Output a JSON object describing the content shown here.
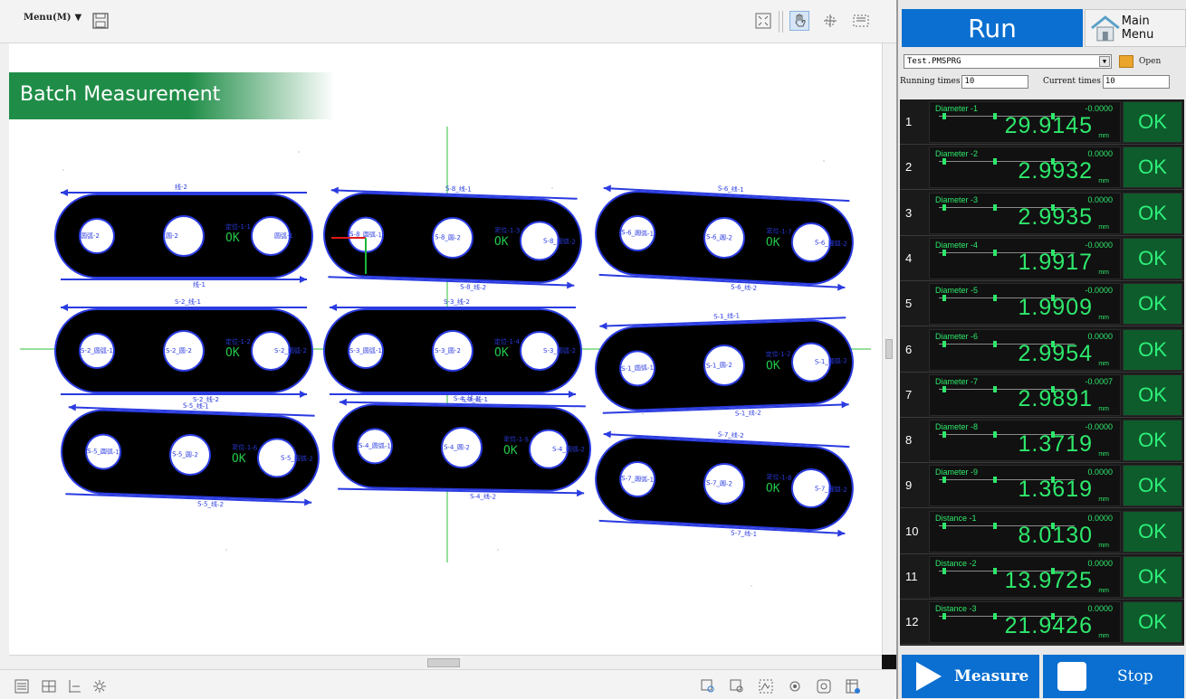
{
  "toolbar": {
    "menu_label": "Menu(M)",
    "icons": [
      "save-icon",
      "fit-screen-icon",
      "hand-pan-icon",
      "crosshair-icon",
      "zoom-region-icon"
    ]
  },
  "banner": {
    "title": "Batch Measurement"
  },
  "accent_color": "#1f8d47",
  "right_panel": {
    "run_label": "Run",
    "main_menu_label": "Main Menu",
    "file": "Test.PMSPRG",
    "open_label": "Open",
    "running_times_label": "Running times",
    "running_times_value": "10",
    "current_times_label": "Current times",
    "current_times_value": "10",
    "ok_color": "#0e5c2c",
    "results": [
      {
        "num": "1",
        "name": "Diameter -1",
        "dev": "-0.0000",
        "value": "29.9145",
        "unit": "mm",
        "status": "OK"
      },
      {
        "num": "2",
        "name": "Diameter -2",
        "dev": "0.0000",
        "value": "2.9932",
        "unit": "mm",
        "status": "OK"
      },
      {
        "num": "3",
        "name": "Diameter -3",
        "dev": "0.0000",
        "value": "2.9935",
        "unit": "mm",
        "status": "OK"
      },
      {
        "num": "4",
        "name": "Diameter -4",
        "dev": "-0.0000",
        "value": "1.9917",
        "unit": "mm",
        "status": "OK"
      },
      {
        "num": "5",
        "name": "Diameter -5",
        "dev": "-0.0000",
        "value": "1.9909",
        "unit": "mm",
        "status": "OK"
      },
      {
        "num": "6",
        "name": "Diameter -6",
        "dev": "0.0000",
        "value": "2.9954",
        "unit": "mm",
        "status": "OK"
      },
      {
        "num": "7",
        "name": "Diameter -7",
        "dev": "-0.0007",
        "value": "2.9891",
        "unit": "mm",
        "status": "OK"
      },
      {
        "num": "8",
        "name": "Diameter -8",
        "dev": "-0.0000",
        "value": "1.3719",
        "unit": "mm",
        "status": "OK"
      },
      {
        "num": "9",
        "name": "Diameter -9",
        "dev": "0.0000",
        "value": "1.3619",
        "unit": "mm",
        "status": "OK"
      },
      {
        "num": "10",
        "name": "Distance -1",
        "dev": "0.0000",
        "value": "8.0130",
        "unit": "mm",
        "status": "OK"
      },
      {
        "num": "11",
        "name": "Distance -2",
        "dev": "0.0000",
        "value": "13.9725",
        "unit": "mm",
        "status": "OK"
      },
      {
        "num": "12",
        "name": "Distance -3",
        "dev": "0.0000",
        "value": "21.9426",
        "unit": "mm",
        "status": "OK"
      }
    ],
    "measure_label": "Measure",
    "stop_label": "Stop"
  },
  "parts": {
    "ok_text": "OK",
    "labels": {
      "p1": [
        "圆弧-2",
        "圆-2",
        "圆弧-1",
        "定位-1-1"
      ],
      "p2": [
        "S-8_圆弧-1",
        "S-8_圆-2",
        "S-8_圆弧-2",
        "定位-1-3"
      ],
      "p3": [
        "S-6_圆弧-1",
        "S-6_圆-2",
        "S-6_圆弧-2",
        "定位-1-7"
      ],
      "p4": [
        "S-2_圆弧-1",
        "S-2_圆-2",
        "S-2_圆弧-2",
        "定位-1-2"
      ],
      "p5": [
        "S-3_圆弧-1",
        "S-3_圆-2",
        "S-3_圆弧-2",
        "定位-1-4"
      ],
      "p6": [
        "S-1_圆弧-1",
        "S-1_圆-2",
        "S-1_圆弧-2",
        "定位-1-2"
      ],
      "p7": [
        "S-5_圆弧-1",
        "S-5_圆-2",
        "S-5_圆弧-2",
        "定位-1-6"
      ],
      "p8": [
        "S-4_圆弧-1",
        "S-4_圆-2",
        "S-4_圆弧-2",
        "定位-1-5"
      ],
      "p9": [
        "S-7_圆弧-1",
        "S-7_圆-2",
        "S-7_圆弧-2",
        "定位-1-8"
      ]
    },
    "line_labels": {
      "p1": [
        "线-2",
        "线-1"
      ],
      "p2": [
        "S-8_线-1",
        "S-8_线-2"
      ],
      "p3": [
        "S-6_线-1",
        "S-6_线-2"
      ],
      "p4": [
        "S-2_线-1",
        "S-2_线-2"
      ],
      "p5": [
        "S-3_线-2",
        "S-3_线-1"
      ],
      "p6": [
        "S-1_线-1",
        "S-1_线-2"
      ],
      "p7": [
        "S-5_线-1",
        "S-5_线-2"
      ],
      "p8": [
        "S-4_线-1",
        "S-4_线-2"
      ],
      "p9": [
        "S-7_线-2",
        "S-7_线-1"
      ]
    }
  }
}
